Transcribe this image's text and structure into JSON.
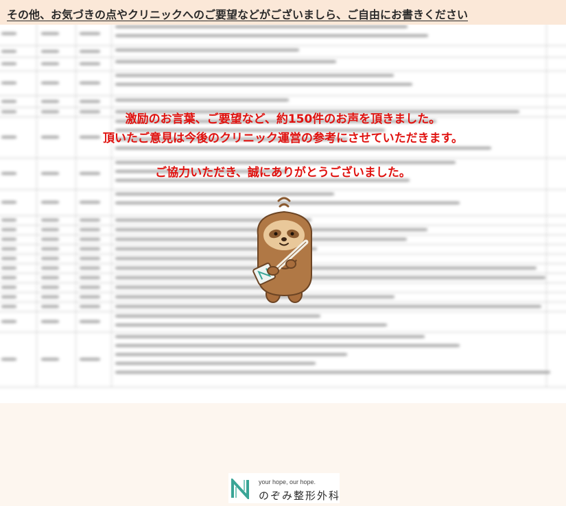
{
  "header": {
    "title": "その他、お気づきの点やクリニックへのご要望などがございましら、ご自由にお書きください"
  },
  "message": {
    "line1": "激励のお言葉、ご要望など、約150件のお声を頂きました。",
    "line2": "頂いたご意見は今後のクリニック運営の参考にさせていただきます。",
    "line3": "ご協力いただき、誠にありがとうございました。"
  },
  "logo": {
    "tagline": "your hope, our hope.",
    "name": "のぞみ整形外科"
  },
  "colors": {
    "background": "#fdf6ef",
    "header_band": "#fbe8d8",
    "message_red": "#e0120f",
    "mascot_brown": "#b07845",
    "logo_teal": "#3aa596"
  },
  "icons": {
    "mascot": "sloth-mascot-icon",
    "logo_mark": "n-logo-icon"
  }
}
